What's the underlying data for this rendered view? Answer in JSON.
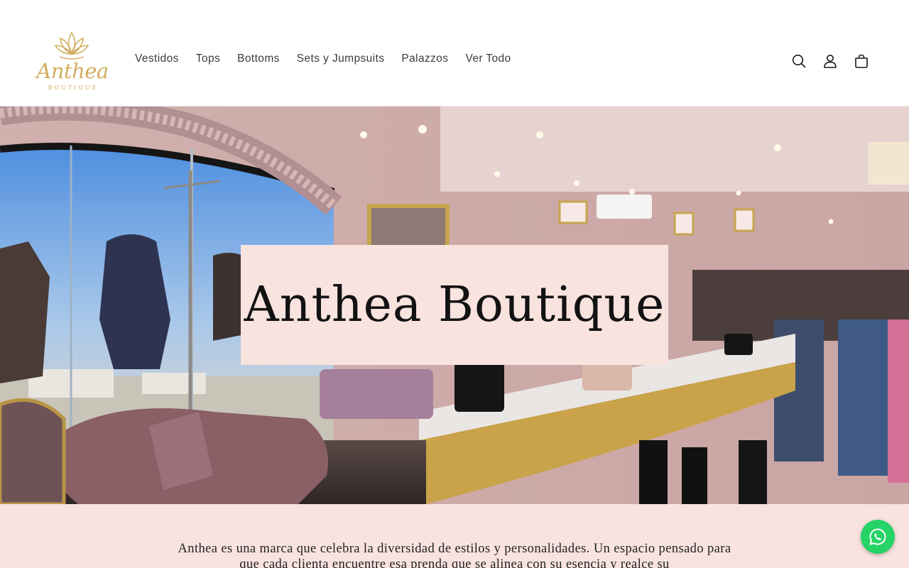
{
  "header": {
    "logo": {
      "brand": "Anthea",
      "sub": "BOUTIQUE"
    },
    "nav": [
      {
        "label": "Vestidos"
      },
      {
        "label": "Tops"
      },
      {
        "label": "Bottoms"
      },
      {
        "label": "Sets y Jumpsuits"
      },
      {
        "label": "Palazzos"
      },
      {
        "label": "Ver Todo"
      }
    ],
    "icons": [
      "search-icon",
      "account-icon",
      "cart-icon"
    ]
  },
  "hero": {
    "title": "Anthea Boutique"
  },
  "intro": {
    "text": "Anthea es una marca que celebra la diversidad de estilos y personalidades. Un espacio pensado para que cada clienta encuentre esa prenda que se alinea con su esencia y realce su"
  },
  "floating": {
    "icon": "whatsapp-icon"
  },
  "colors": {
    "accent_gold": "#d2ad5e",
    "blush": "#f8e3df",
    "whatsapp_green": "#25d366",
    "text": "#121212"
  }
}
